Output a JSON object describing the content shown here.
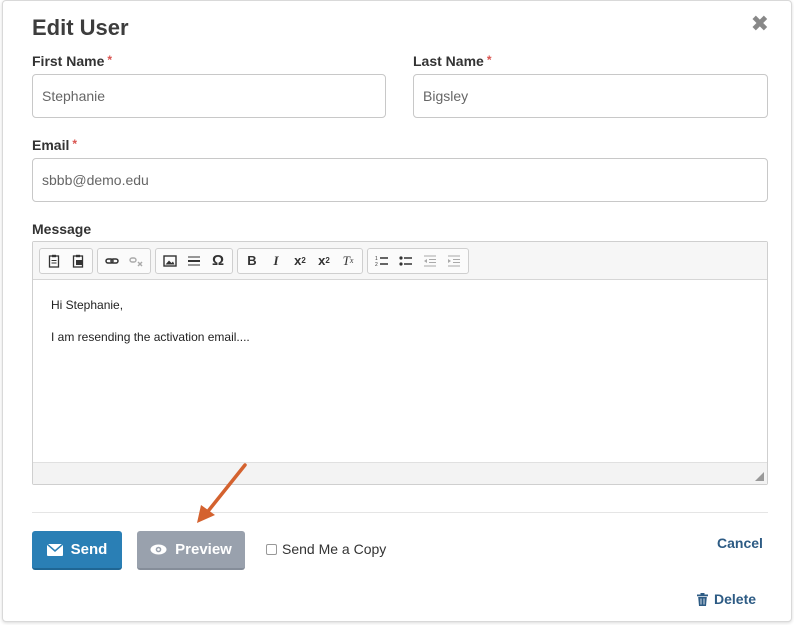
{
  "dialog": {
    "title": "Edit User",
    "close_icon": "✖"
  },
  "form": {
    "first_name": {
      "label": "First Name",
      "required": "*",
      "value": "Stephanie"
    },
    "last_name": {
      "label": "Last Name",
      "required": "*",
      "value": "Bigsley"
    },
    "email": {
      "label": "Email",
      "required": "*",
      "value": "sbbb@demo.edu"
    },
    "message": {
      "label": "Message",
      "lines": [
        "Hi Stephanie,",
        "I am resending the activation email...."
      ]
    }
  },
  "toolbar": {
    "icons": [
      "paste-icon",
      "paste-text-icon",
      "link-icon",
      "unlink-icon",
      "image-icon",
      "horizontal-line-icon",
      "special-char-icon",
      "bold-icon",
      "italic-icon",
      "subscript-icon",
      "superscript-icon",
      "remove-format-icon",
      "numbered-list-icon",
      "bullet-list-icon",
      "outdent-icon",
      "indent-icon"
    ]
  },
  "actions": {
    "send_label": "Send",
    "preview_label": "Preview",
    "copy_label": "Send Me a Copy",
    "cancel_label": "Cancel",
    "delete_label": "Delete"
  },
  "colors": {
    "send": "#2a7fb5",
    "preview": "#99a1ad",
    "required": "#d9534f",
    "link": "#2d5b84",
    "arrow": "#d4622f"
  }
}
